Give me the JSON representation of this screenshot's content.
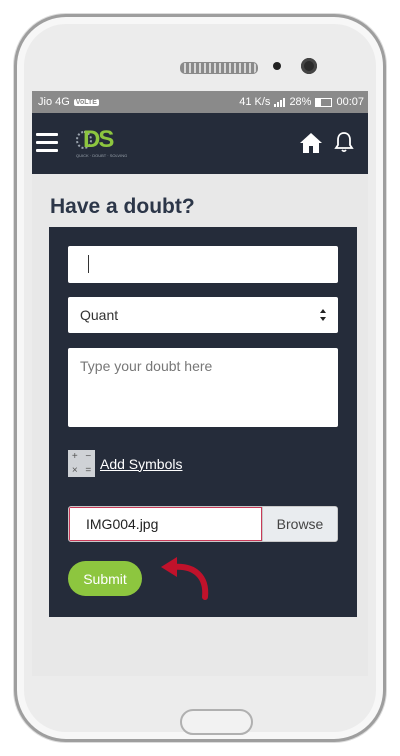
{
  "status": {
    "carrier": "Jio 4G",
    "lte": "VoLTE",
    "speed": "41 K/s",
    "battery_percent": "28%",
    "time": "00:07"
  },
  "app": {
    "logo_text": "DS",
    "logo_tagline": "QUICK · DOUBT · SOLVING"
  },
  "page": {
    "title": "Have a doubt?"
  },
  "form": {
    "subject_selected": "Quant",
    "doubt_placeholder": "Type your doubt here",
    "add_symbols_label": "Add Symbols",
    "file_name": "IMG004.jpg",
    "browse_label": "Browse",
    "submit_label": "Submit"
  },
  "colors": {
    "app_bar": "#252c3a",
    "accent": "#8dc63f",
    "arrow": "#c0122b"
  },
  "icons": [
    "menu-icon",
    "home-icon",
    "bell-icon",
    "calculator-icon",
    "curved-arrow-icon"
  ]
}
